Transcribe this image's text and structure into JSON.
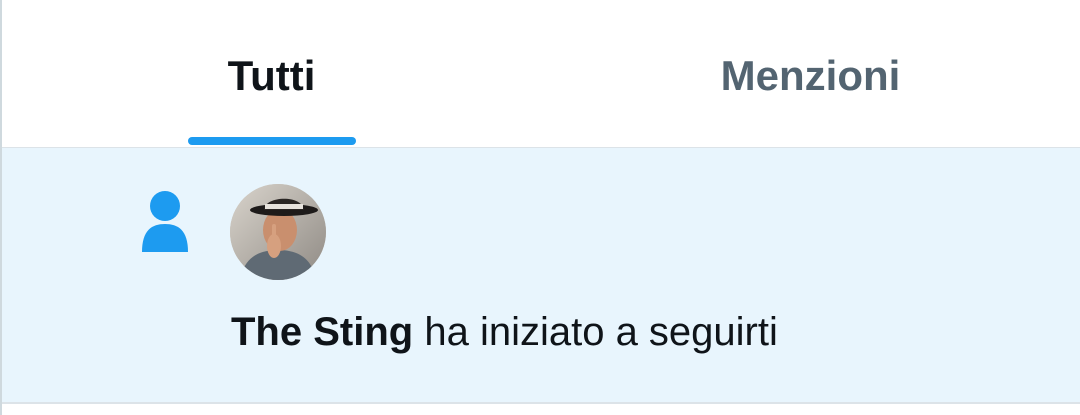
{
  "tabs": [
    {
      "label": "Tutti",
      "active": true
    },
    {
      "label": "Menzioni",
      "active": false
    }
  ],
  "notification": {
    "type_icon": "person-icon",
    "avatar_icon": "user-avatar",
    "user_name": "The Sting",
    "action_text": " ha iniziato a seguirti"
  },
  "colors": {
    "accent": "#1d9bf0",
    "highlight_bg": "#e8f5fd",
    "text_primary": "#0f1419",
    "text_secondary": "#536471"
  }
}
